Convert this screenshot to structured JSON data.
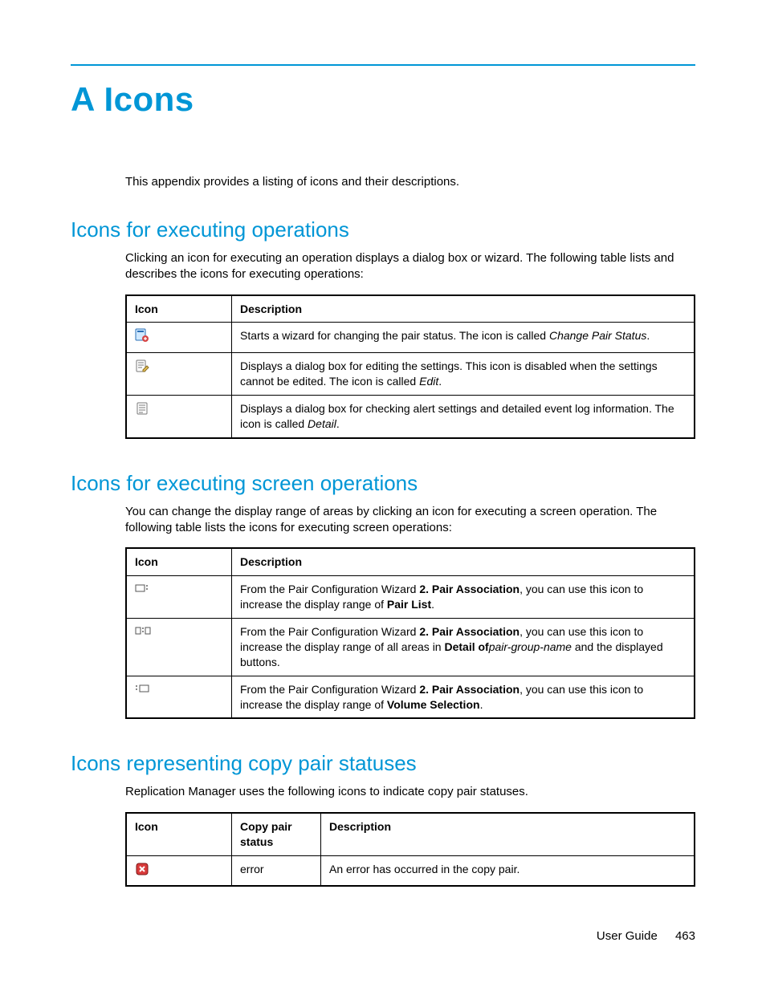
{
  "title": "A Icons",
  "intro": "This appendix provides a listing of icons and their descriptions.",
  "section1": {
    "heading": "Icons for executing operations",
    "body": "Clicking an icon for executing an operation displays a dialog box or wizard. The following table lists and describes the icons for executing operations:",
    "cols": {
      "icon": "Icon",
      "desc": "Description"
    },
    "rows": [
      {
        "icon_name": "change-pair-status-icon",
        "desc_pre": "Starts a wizard for changing the pair status. The icon is called ",
        "desc_em": "Change Pair Status",
        "desc_post": "."
      },
      {
        "icon_name": "edit-icon",
        "desc_pre": "Displays a dialog box for editing the settings. This icon is disabled when the settings cannot be edited. The icon is called ",
        "desc_em": "Edit",
        "desc_post": "."
      },
      {
        "icon_name": "detail-icon",
        "desc_pre": "Displays a dialog box for checking alert settings and detailed event log information. The icon is called ",
        "desc_em": "Detail",
        "desc_post": "."
      }
    ]
  },
  "section2": {
    "heading": "Icons for executing screen operations",
    "body": "You can change the display range of areas by clicking an icon for executing a screen operation. The following table lists the icons for executing screen operations:",
    "cols": {
      "icon": "Icon",
      "desc": "Description"
    },
    "rows": [
      {
        "icon_name": "expand-pair-list-icon",
        "parts": [
          {
            "t": "From the Pair Configuration Wizard "
          },
          {
            "t": "2. Pair Association",
            "b": true
          },
          {
            "t": ", you can use this icon to increase the display range of "
          },
          {
            "t": "Pair List",
            "b": true
          },
          {
            "t": "."
          }
        ]
      },
      {
        "icon_name": "expand-detail-icon",
        "parts": [
          {
            "t": "From the Pair Configuration Wizard "
          },
          {
            "t": "2. Pair Association",
            "b": true
          },
          {
            "t": ", you can use this icon to increase the display range of all areas in "
          },
          {
            "t": "Detail of",
            "b": true
          },
          {
            "t": "pair-group-name",
            "i": true
          },
          {
            "t": " and the displayed buttons."
          }
        ]
      },
      {
        "icon_name": "expand-volume-selection-icon",
        "parts": [
          {
            "t": "From the Pair Configuration Wizard "
          },
          {
            "t": "2. Pair Association",
            "b": true
          },
          {
            "t": ", you can use this icon to increase the display range of "
          },
          {
            "t": "Volume Selection",
            "b": true
          },
          {
            "t": "."
          }
        ]
      }
    ]
  },
  "section3": {
    "heading": "Icons representing copy pair statuses",
    "body": "Replication Manager uses the following icons to indicate copy pair statuses.",
    "cols": {
      "icon": "Icon",
      "status": "Copy pair status",
      "desc": "Description"
    },
    "rows": [
      {
        "icon_name": "error-status-icon",
        "status": "error",
        "desc": "An error has occurred in the copy pair."
      }
    ]
  },
  "footer": {
    "label": "User Guide",
    "page": "463"
  }
}
